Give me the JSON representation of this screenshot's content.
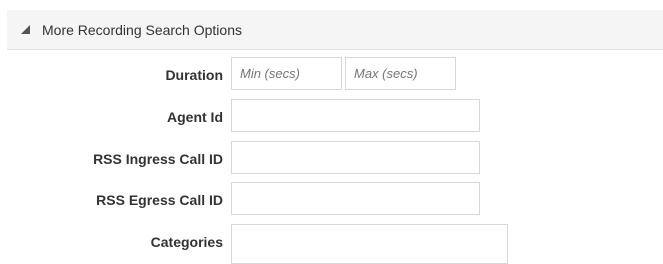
{
  "section": {
    "title": "More Recording Search Options",
    "toggle_icon": "triangle-expanded-icon"
  },
  "form": {
    "duration": {
      "label": "Duration",
      "min_placeholder": "Min (secs)",
      "max_placeholder": "Max (secs)",
      "min_value": "",
      "max_value": ""
    },
    "agent_id": {
      "label": "Agent Id",
      "value": ""
    },
    "rss_ingress_call_id": {
      "label": "RSS Ingress Call ID",
      "value": ""
    },
    "rss_egress_call_id": {
      "label": "RSS Egress Call ID",
      "value": ""
    },
    "categories": {
      "label": "Categories",
      "value": ""
    }
  }
}
